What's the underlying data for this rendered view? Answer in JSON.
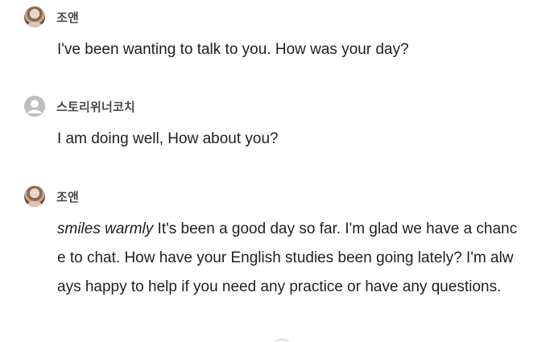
{
  "messages": [
    {
      "author": "조앤",
      "avatar": "user-photo-avatar",
      "text": "I've been wanting to talk to you. How was your day?"
    },
    {
      "author": "스토리위너코치",
      "avatar": "default-person-icon",
      "text": "I am doing well, How about you?"
    },
    {
      "author": "조앤",
      "avatar": "user-photo-avatar",
      "action": "smiles warmly",
      "text": " It's been a good day so far. I'm glad we have a chance to chat. How have your English studies been going lately? I'm always happy to help if you need any practice or have any questions."
    }
  ]
}
